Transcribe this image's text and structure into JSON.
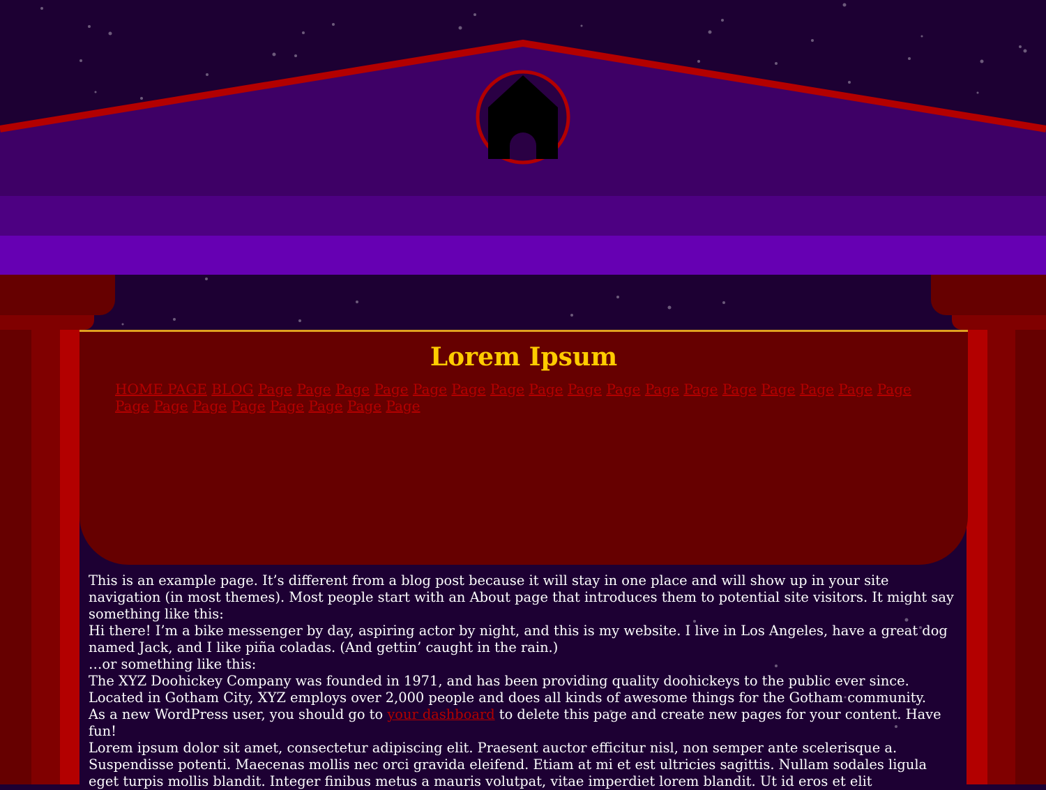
{
  "colors": {
    "sky": "#1d0033",
    "roof_fill": "#3e0066",
    "roof_edge": "#b30000",
    "band_dark": "#4d0082",
    "band_light": "#6600b3",
    "column_dark": "#660000",
    "column_mid": "#800000",
    "column_bright": "#b30000",
    "header_bg": "#660000",
    "header_border": "#e0a020",
    "title": "#ffcc00",
    "link": "#b30000",
    "text": "#ffffff"
  },
  "logo": {
    "icon": "house-icon"
  },
  "site": {
    "title": "Lorem Ipsum"
  },
  "nav": {
    "items": [
      "HOME PAGE",
      "BLOG",
      "Page",
      "Page",
      "Page",
      "Page",
      "Page",
      "Page",
      "Page",
      "Page",
      "Page",
      "Page",
      "Page",
      "Page",
      "Page",
      "Page",
      "Page",
      "Page",
      "Page",
      "Page",
      "Page",
      "Page",
      "Page",
      "Page",
      "Page",
      "Page",
      "Page"
    ]
  },
  "content": {
    "p1": "This is an example page. It’s different from a blog post because it will stay in one place and will show up in your site navigation (in most themes). Most people start with an About page that introduces them to potential site visitors. It might say something like this:",
    "p2": "Hi there! I’m a bike messenger by day, aspiring actor by night, and this is my website. I live in Los Angeles, have a great dog named Jack, and I like piña coladas. (And gettin’ caught in the rain.)",
    "p3": "…or something like this:",
    "p4": "The XYZ Doohickey Company was founded in 1971, and has been providing quality doohickeys to the public ever since. Located in Gotham City, XYZ employs over 2,000 people and does all kinds of awesome things for the Gotham community.",
    "p5_before": "As a new WordPress user, you should go to ",
    "p5_link": "your dashboard",
    "p5_after": " to delete this page and create new pages for your content. Have fun!",
    "p6": "Lorem ipsum dolor sit amet, consectetur adipiscing elit. Praesent auctor efficitur nisl, non semper ante scelerisque a. Suspendisse potenti. Maecenas mollis nec orci gravida eleifend. Etiam at mi et est ultricies sagittis. Nullam sodales ligula eget turpis mollis blandit. Integer finibus metus a mauris volutpat, vitae imperdiet lorem blandit. Ut id eros et elit"
  }
}
